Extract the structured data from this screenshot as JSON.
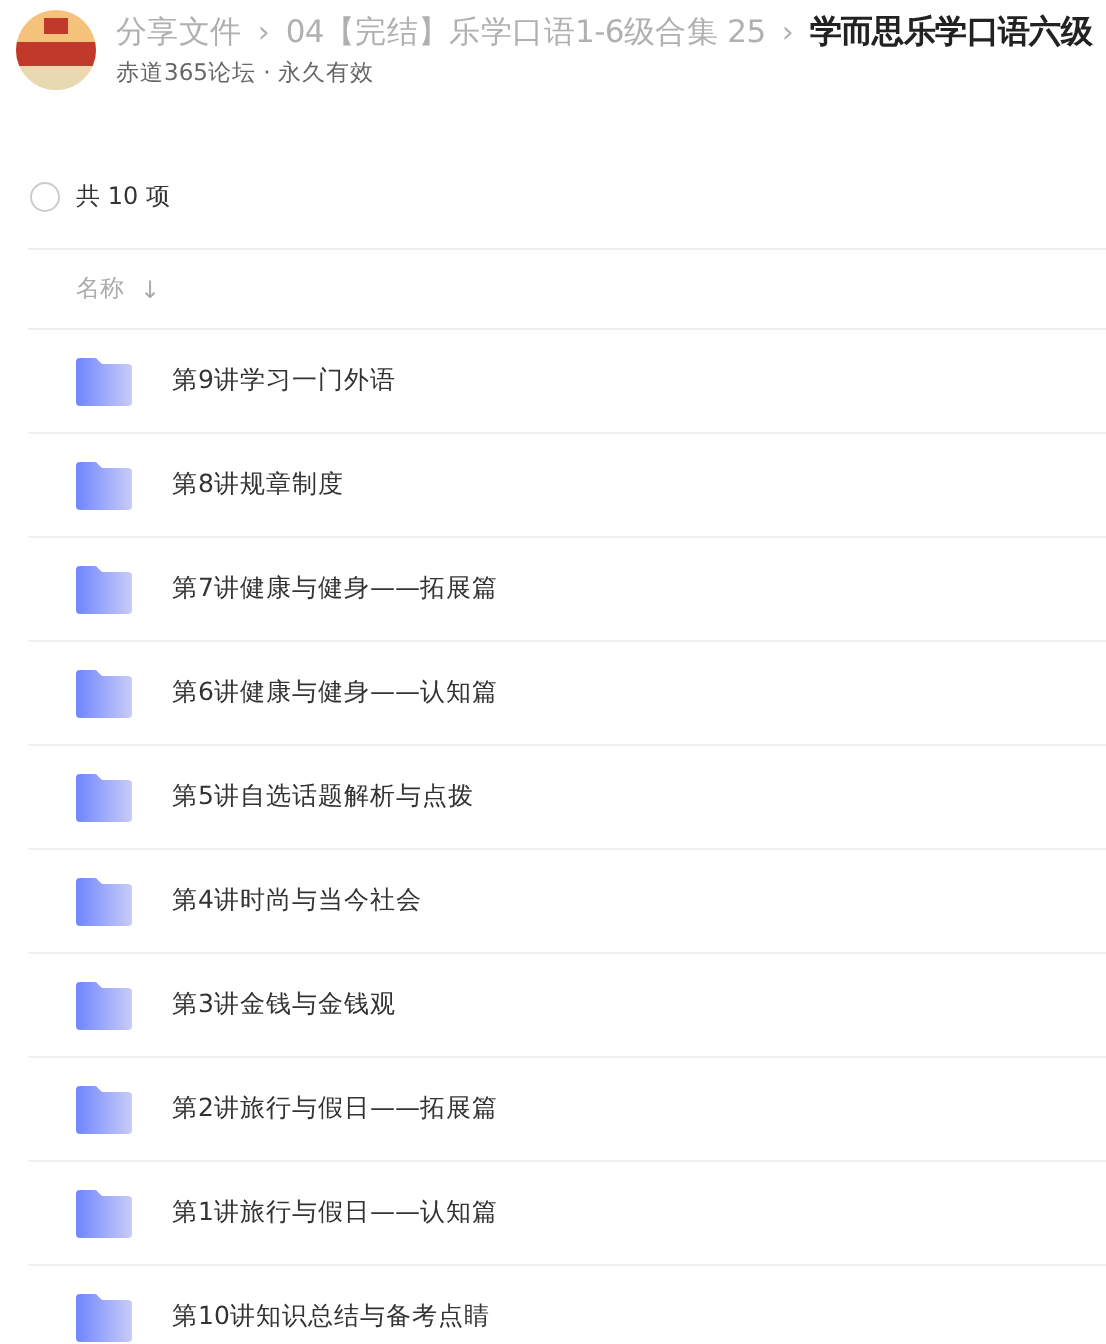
{
  "header": {
    "breadcrumb": [
      {
        "label": "分享文件",
        "current": false
      },
      {
        "label": "04【完结】乐学口语1-6级合集 25",
        "current": false
      },
      {
        "label": "学而思乐学口语六级",
        "current": true
      }
    ],
    "separator": "›",
    "subtitle": "赤道365论坛 · 永久有效"
  },
  "selection": {
    "checked": false,
    "count": "共 10 项"
  },
  "columns": [
    {
      "label": "名称",
      "sort": "↓"
    }
  ],
  "files": [
    {
      "name": "第9讲学习一门外语"
    },
    {
      "name": "第8讲规章制度"
    },
    {
      "name": "第7讲健康与健身——拓展篇"
    },
    {
      "name": "第6讲健康与健身——认知篇"
    },
    {
      "name": "第5讲自选话题解析与点拨"
    },
    {
      "name": "第4讲时尚与当今社会"
    },
    {
      "name": "第3讲金钱与金钱观"
    },
    {
      "name": "第2讲旅行与假日——拓展篇"
    },
    {
      "name": "第1讲旅行与假日——认知篇"
    },
    {
      "name": "第10讲知识总结与备考点睛"
    }
  ]
}
